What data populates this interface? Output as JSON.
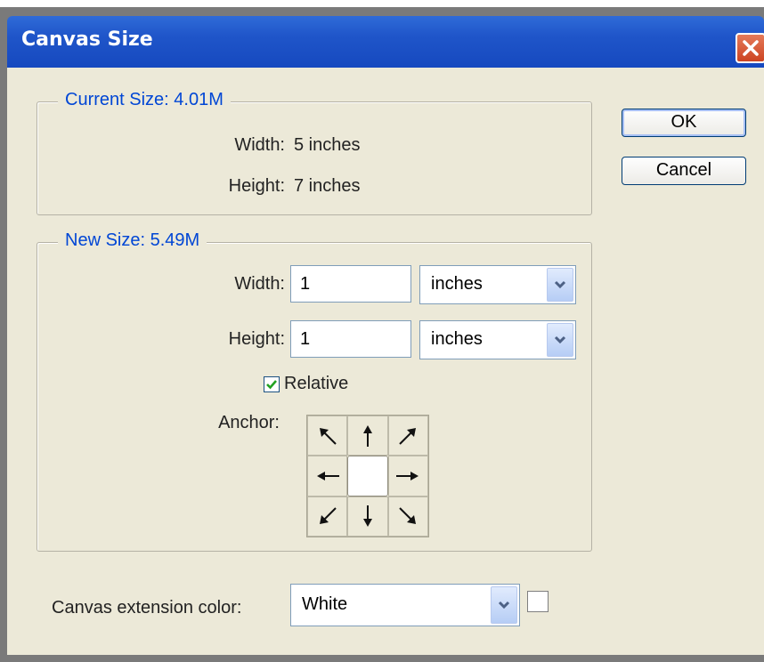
{
  "window": {
    "title": "Canvas Size"
  },
  "current_size": {
    "legend": "Current Size: 4.01M",
    "width_label": "Width:",
    "width_value": "5 inches",
    "height_label": "Height:",
    "height_value": "7 inches"
  },
  "new_size": {
    "legend": "New Size: 5.49M",
    "width_label": "Width:",
    "width_value": "1",
    "width_unit": "inches",
    "height_label": "Height:",
    "height_value": "1",
    "height_unit": "inches",
    "relative_label": "Relative",
    "relative_checked": true,
    "anchor_label": "Anchor:",
    "anchor_selected": "center"
  },
  "extension": {
    "label": "Canvas extension color:",
    "value": "White",
    "swatch_color": "#ffffff"
  },
  "buttons": {
    "ok": "OK",
    "cancel": "Cancel"
  }
}
